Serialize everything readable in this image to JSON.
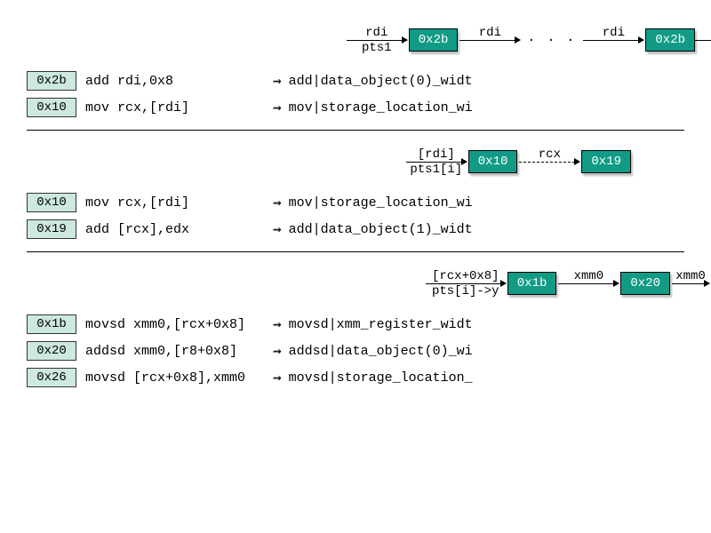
{
  "sections": [
    {
      "flow": {
        "align": "right",
        "items": [
          {
            "type": "arrow",
            "top": "rdi",
            "bot": "pts1",
            "style": "solid",
            "len": "long"
          },
          {
            "type": "node",
            "label": "0x2b"
          },
          {
            "type": "arrow",
            "top": "rdi",
            "style": "solid",
            "len": "long"
          },
          {
            "type": "dots",
            "text": "· · ·"
          },
          {
            "type": "arrow",
            "top": "rdi",
            "style": "solid",
            "len": "long"
          },
          {
            "type": "node",
            "label": "0x2b"
          },
          {
            "type": "arrow",
            "style": "solid",
            "len": "short",
            "cutoff": true
          }
        ]
      },
      "rows": [
        {
          "addr": "0x2b",
          "asm": "add rdi,0x8",
          "arrow": "⇝",
          "desc": "add|data_object(0)_widt"
        },
        {
          "addr": "0x10",
          "asm": "mov rcx,[rdi]",
          "arrow": "⇝",
          "desc": "mov|storage_location_wi"
        }
      ]
    },
    {
      "flow": {
        "align": "right-inset",
        "items": [
          {
            "type": "arrow",
            "top": "[rdi]",
            "bot": "pts1[i]",
            "style": "solid",
            "len": "long"
          },
          {
            "type": "node",
            "label": "0x10"
          },
          {
            "type": "arrow",
            "top": "rcx",
            "style": "dashed",
            "len": "long"
          },
          {
            "type": "node",
            "label": "0x19"
          }
        ]
      },
      "rows": [
        {
          "addr": "0x10",
          "asm": "mov rcx,[rdi]",
          "arrow": "⇝",
          "desc": "mov|storage_location_wi"
        },
        {
          "addr": "0x19",
          "asm": "add [rcx],edx",
          "arrow": "⇝",
          "desc": "add|data_object(1)_widt"
        }
      ]
    },
    {
      "flow": {
        "align": "right-edge",
        "items": [
          {
            "type": "arrow",
            "top": "[rcx+0x8]",
            "bot": "pts[i]->y",
            "style": "solid",
            "len": "long"
          },
          {
            "type": "node",
            "label": "0x1b"
          },
          {
            "type": "arrow",
            "top": "xmm0",
            "style": "solid",
            "len": "long"
          },
          {
            "type": "node",
            "label": "0x20"
          },
          {
            "type": "arrow",
            "top": "xmm0",
            "style": "solid",
            "len": "short",
            "cutoff": true
          }
        ]
      },
      "rows": [
        {
          "addr": "0x1b",
          "asm": "movsd xmm0,[rcx+0x8]",
          "arrow": "⇝",
          "desc": "movsd|xmm_register_widt"
        },
        {
          "addr": "0x20",
          "asm": "addsd xmm0,[r8+0x8]",
          "arrow": "⇝",
          "desc": "addsd|data_object(0)_wi"
        },
        {
          "addr": "0x26",
          "asm": "movsd [rcx+0x8],xmm0",
          "arrow": "⇝",
          "desc": "movsd|storage_location_"
        }
      ]
    }
  ]
}
